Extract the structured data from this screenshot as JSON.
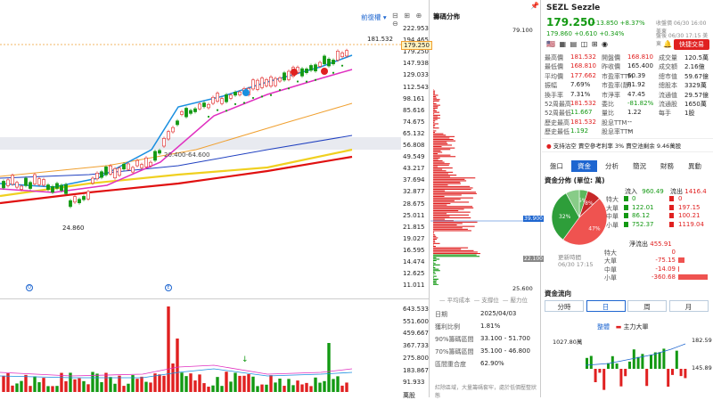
{
  "chart": {
    "toolbar": {
      "dropdown_label": "前復權"
    },
    "price_ticks": [
      "222.953",
      "194.465",
      "179.250",
      "147.938",
      "129.033",
      "112.543",
      "98.161",
      "85.616",
      "74.675",
      "65.132",
      "56.808",
      "49.549",
      "43.217",
      "37.694",
      "32.877",
      "28.675",
      "25.011",
      "21.815",
      "19.027",
      "16.595",
      "14.474",
      "12.625",
      "11.011"
    ],
    "last_label": "181.532",
    "low_label": "24.860",
    "ma_label": "20.400-64.600",
    "vol_ticks": [
      "643.533",
      "551.600",
      "459.667",
      "367.733",
      "275.800",
      "183.867",
      "91.933",
      "萬股"
    ],
    "colors": {
      "up": "#e02020",
      "down": "#139913",
      "ma_blue": "#1a8fe0",
      "ma_pink": "#e030c0",
      "ma_orange": "#f0a030",
      "ma_navy": "#2040c0",
      "ma_yellow": "#f0d020",
      "ma_red": "#e01010"
    }
  },
  "chip": {
    "title": "籌碼分佈",
    "top_value": "79.100",
    "bottom_value": "25.600",
    "marker_high": "39.900",
    "marker_low": "22.100",
    "legend": [
      "平均成本",
      "支撐位",
      "壓力位"
    ],
    "stats": [
      {
        "label": "日期",
        "value": "2025/04/03"
      },
      {
        "label": "獲利比例",
        "value": "1.81%"
      },
      {
        "label": "90%籌碼區間",
        "value": "33.100 - 51.700"
      },
      {
        "label": "70%籌碼區間",
        "value": "35.100 - 46.800"
      },
      {
        "label": "區間重合度",
        "value": "62.90%"
      }
    ],
    "note": "紅除區域，大量籌碼套牢，處於低價壓整狀態"
  },
  "quote": {
    "symbol": "SEZL",
    "name": "Sezzle",
    "price": "179.250",
    "change": "+13.850 +8.37%",
    "status_close": "收盤價 06/30 16:00 美東",
    "post_price": "179.860",
    "post_change": "+0.610 +0.34%",
    "status_post": "盤後 06/30 17:15 美東",
    "trade_button": "快捷交易",
    "fields": [
      {
        "label": "最高價",
        "value": "181.532",
        "color": "up"
      },
      {
        "label": "開盤價",
        "value": "168.810",
        "color": "up"
      },
      {
        "label": "成交量",
        "value": "120.5萬"
      },
      {
        "label": "最低價",
        "value": "168.810",
        "color": "up"
      },
      {
        "label": "昨收價",
        "value": "165.400"
      },
      {
        "label": "成交額",
        "value": "2.16億"
      },
      {
        "label": "平均價",
        "value": "177.662",
        "color": "up"
      },
      {
        "label": "市盈率TTM",
        "value": "60.39"
      },
      {
        "label": "總市值",
        "value": "59.67億"
      },
      {
        "label": "振幅",
        "value": "7.69%"
      },
      {
        "label": "市盈率(靜)",
        "value": "81.92"
      },
      {
        "label": "總股本",
        "value": "3329萬"
      },
      {
        "label": "換手率",
        "value": "7.31%"
      },
      {
        "label": "市淨率",
        "value": "47.45"
      },
      {
        "label": "流通值",
        "value": "29.57億"
      },
      {
        "label": "52周最高",
        "value": "181.532",
        "color": "up"
      },
      {
        "label": "委比",
        "value": "-81.82%",
        "color": "down"
      },
      {
        "label": "流通股",
        "value": "1650萬"
      },
      {
        "label": "52周最低",
        "value": "11.667",
        "color": "down"
      },
      {
        "label": "量比",
        "value": "1.22"
      },
      {
        "label": "每手",
        "value": "1股"
      },
      {
        "label": "歷史最高",
        "value": "181.532",
        "color": "up"
      },
      {
        "label": "股息TTM",
        "value": "--"
      },
      {
        "label": "",
        "value": ""
      },
      {
        "label": "歷史最低",
        "value": "1.192",
        "color": "down"
      },
      {
        "label": "股息率TTM",
        "value": "--"
      },
      {
        "label": "",
        "value": ""
      }
    ],
    "short_info": "支持沽空  賣空參考利率 3%  賣空池剩余 9.46萬股",
    "tabs": [
      "盤口",
      "資金",
      "分析",
      "簡況",
      "財務",
      "異動"
    ],
    "active_tab": "資金",
    "fund_title": "資金分佈 (單位: 萬)",
    "inflow_label": "流入",
    "inflow_total": "960.49",
    "outflow_label": "流出",
    "outflow_total": "1416.4",
    "pie": [
      {
        "label": "5%",
        "value": 5,
        "color": "#5cb85c"
      },
      {
        "label": "8%",
        "value": 8,
        "color": "#c62828"
      },
      {
        "label": "47%",
        "value": 47,
        "color": "#ef5350"
      },
      {
        "label": "32%",
        "value": 32,
        "color": "#2e9e3a"
      },
      {
        "label": "",
        "value": 8,
        "color": "#88cc88"
      }
    ],
    "fund_rows": [
      {
        "label": "特大",
        "in": "0",
        "out": "0"
      },
      {
        "label": "大單",
        "in": "122.01",
        "out": "197.15"
      },
      {
        "label": "中單",
        "in": "86.12",
        "out": "100.21"
      },
      {
        "label": "小單",
        "in": "752.37",
        "out": "1119.04"
      }
    ],
    "net_label": "淨流出",
    "net_value": "455.91",
    "update_label": "更新時間",
    "update_time": "06/30 17:15",
    "net_rows": [
      {
        "label": "特大",
        "value": "0",
        "ratio": 0
      },
      {
        "label": "大單",
        "value": "-75.15",
        "ratio": 0.2
      },
      {
        "label": "中單",
        "value": "-14.09",
        "ratio": 0.04
      },
      {
        "label": "小單",
        "value": "-360.68",
        "ratio": 1
      }
    ],
    "flow_title": "資金流向",
    "flow_tabs": [
      "分時",
      "日",
      "周",
      "月"
    ],
    "active_flow_tab": "日",
    "flow_legend": [
      "整體",
      "主力大單"
    ],
    "flow_top": "1027.80萬",
    "flow_right_top": "182.59",
    "flow_right_bottom": "145.89"
  }
}
